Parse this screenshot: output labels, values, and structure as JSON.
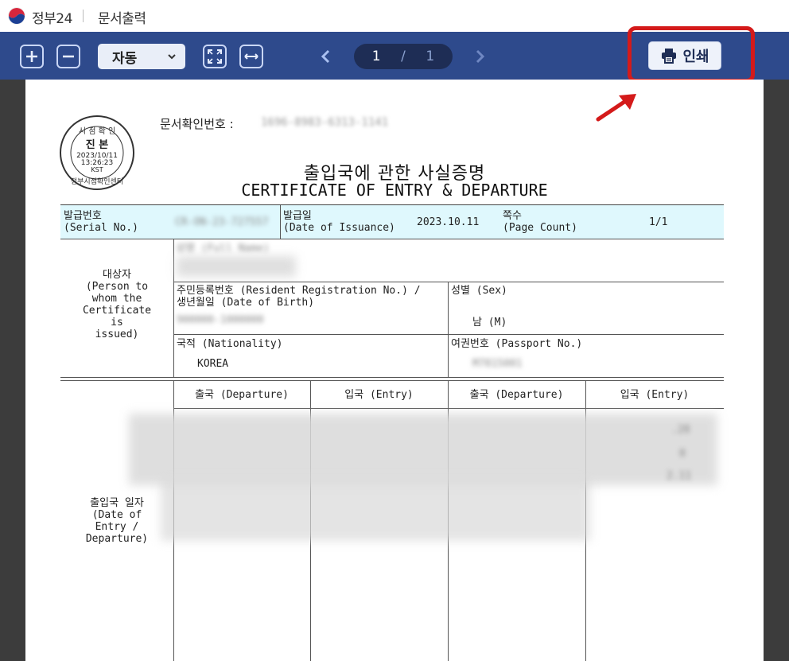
{
  "titlebar": {
    "app_name": "정부24",
    "doc_title": "문서출력"
  },
  "toolbar": {
    "zoom_in_label": "+",
    "zoom_out_label": "−",
    "zoom_value": "자동",
    "current_page": "1",
    "page_separator": "/",
    "total_pages": "1",
    "print_label": "인쇄",
    "accent_color": "#2e4a8c",
    "highlight_color": "#d41a1a"
  },
  "document": {
    "stamp": {
      "top_text": "시 점 확 인",
      "main_text": "진 본",
      "date": "2023/10/11",
      "time": "13:26:23",
      "tz": "KST",
      "bottom_text": "정부시점확인센터"
    },
    "verification": {
      "label": "문서확인번호 :",
      "value": "1696-8983-6313-1141"
    },
    "title_ko": "출입국에 관한 사실증명",
    "title_en": "CERTIFICATE OF ENTRY & DEPARTURE",
    "serial": {
      "label_ko": "발급번호",
      "label_en": "(Serial No.)",
      "value": "CR-ON-23-727557"
    },
    "issuance": {
      "label_ko": "발급일",
      "label_en": "(Date of Issuance)",
      "value": "2023.10.11"
    },
    "page_count": {
      "label_ko": "쪽수",
      "label_en": "(Page Count)",
      "value": "1/1"
    },
    "subject": {
      "label": "대상자\n(Person to\nwhom the\nCertificate\nis\nissued)"
    },
    "full_name_label": "성명 (Full Name)",
    "resident_label": "주민등록번호 (Resident Registration No.) /\n생년월일 (Date of Birth)",
    "resident_value": "900000-1000000",
    "sex_label": "성별 (Sex)",
    "sex_value": "남 (M)",
    "nationality_label": "국적 (Nationality)",
    "nationality_value": "KOREA",
    "passport_label": "여권번호 (Passport No.)",
    "passport_value": "M7815001",
    "records_header": {
      "col1": "출국 (Departure)",
      "col2": "입국 (Entry)",
      "col3": "출국 (Departure)",
      "col4": "입국 (Entry)"
    },
    "records_row_label": "출입국 일자\n(Date of\nEntry /\nDeparture)",
    "records_partial": [
      ".28",
      "0",
      "2.11"
    ]
  }
}
